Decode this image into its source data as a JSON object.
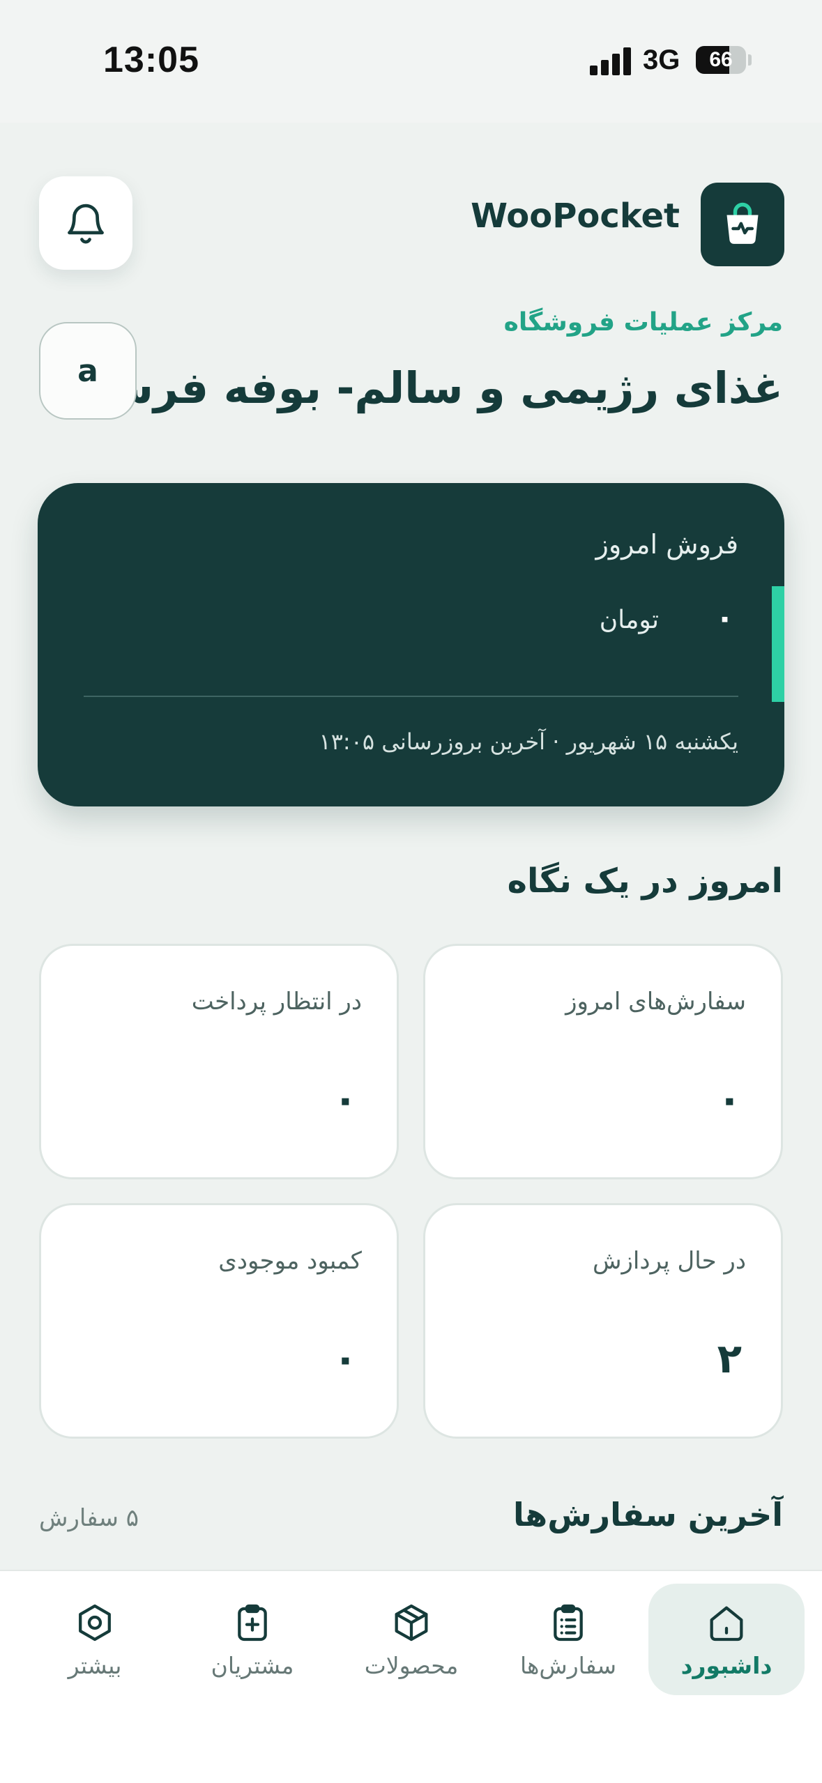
{
  "status_bar": {
    "time": "13:05",
    "network": "3G",
    "battery": "66",
    "battery_level": 0.66
  },
  "header": {
    "brand_name": "WooPocket",
    "brand_icon": "shopping-bag-pulse-icon",
    "notification_icon": "bell-icon"
  },
  "store": {
    "subtitle": "مرکز عملیات فروشگاه",
    "name": "غذای رژیمی و سالم- بوفه فرشریا",
    "avatar_letter": "a"
  },
  "sales_card": {
    "label": "فروش امروز",
    "value": "۰",
    "unit": "تومان",
    "date_line": "یکشنبه ۱۵ شهریور · آخرین بروزرسانی ۱۳:۰۵",
    "bg_color": "#163b3a",
    "accent_color": "#2ed0a5"
  },
  "glance": {
    "title": "امروز در یک نگاه",
    "stats": [
      {
        "label": "سفارش‌های امروز",
        "value": "۰"
      },
      {
        "label": "در انتظار پرداخت",
        "value": "۰"
      },
      {
        "label": "در حال پردازش",
        "value": "۲"
      },
      {
        "label": "کمبود موجودی",
        "value": "۰"
      }
    ]
  },
  "recent_orders": {
    "title": "آخرین سفارش‌ها",
    "count": "۵ سفارش"
  },
  "tabs": [
    {
      "label": "داشبورد",
      "icon": "home-icon",
      "active": true
    },
    {
      "label": "سفارش‌ها",
      "icon": "clipboard-list-icon",
      "active": false
    },
    {
      "label": "محصولات",
      "icon": "box-icon",
      "active": false
    },
    {
      "label": "مشتریان",
      "icon": "clipboard-plus-icon",
      "active": false
    },
    {
      "label": "بیشتر",
      "icon": "settings-icon",
      "active": false
    }
  ],
  "colors": {
    "primary": "#153b3a",
    "accent": "#22a387",
    "background": "#eef2f0"
  }
}
